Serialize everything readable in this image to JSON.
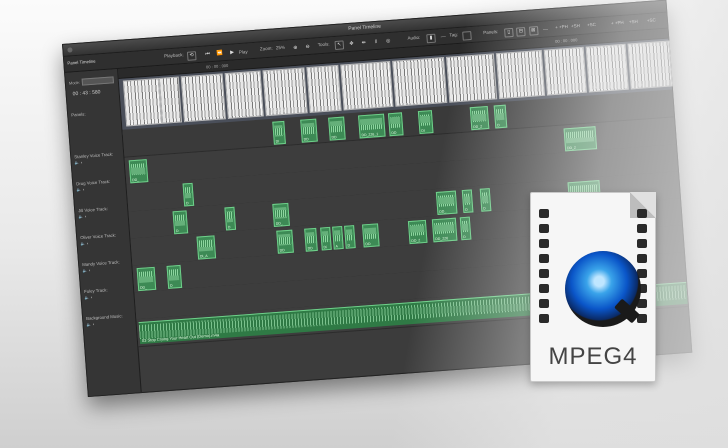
{
  "window": {
    "title": "Panel Timeline"
  },
  "toolbar": {
    "playback": "Playback:",
    "play": "Play",
    "zoom": "Zoom:",
    "zoom_value": "25%",
    "tools": "Tools:",
    "audio": "Audio:",
    "tag": "Tag:",
    "panels": "Panels:",
    "labels": [
      "+PH",
      "+SH",
      "+SC",
      "+PH",
      "+SH",
      "+SC"
    ]
  },
  "sidebar": {
    "title": "Panel Timeline",
    "mode_label": "Mode:",
    "timecode": "00 : 43 : 580",
    "panels_label": "Panels:",
    "tracks": [
      "Stanley Voice Track:",
      "Drug Voice Track:",
      "Jill Voice Track:",
      "Oliver Voice Track:",
      "Mandy Voice Track:",
      "Foley Track:",
      "Background Music:"
    ]
  },
  "ruler": {
    "marks": [
      "00 : 00 : 000",
      "00 : 00 : 000"
    ]
  },
  "panels": {
    "labels": [
      "EP",
      "EP2",
      "EP",
      "EP236_1",
      "EP",
      "EP",
      "EP",
      "EP3",
      "EP",
      "EP5"
    ],
    "top_labels": [
      "EP",
      "EP",
      "EP",
      "EP3",
      "EP",
      "EP5"
    ]
  },
  "clips": {
    "stanley": [
      "DD_",
      "DD_2"
    ],
    "drug": [
      "D"
    ],
    "jill": [
      "D",
      "D",
      "DD_",
      "DD_",
      "D",
      "D",
      "DD_2"
    ],
    "oliver": [
      "DI_A",
      "DD",
      "DD",
      "Di",
      "A",
      "D",
      "DD",
      "DD_2",
      "DD_226",
      "D"
    ],
    "mandy": [
      "DD_",
      "D"
    ],
    "upper": [
      "DI",
      "DD",
      "DD",
      "DD_226_1",
      "DD",
      "DI",
      "DD_2",
      "D"
    ]
  },
  "music": {
    "name": "03 Stop Crying Your Heart Out (Demo).m4a"
  },
  "file_icon": {
    "label": "MPEG4"
  }
}
